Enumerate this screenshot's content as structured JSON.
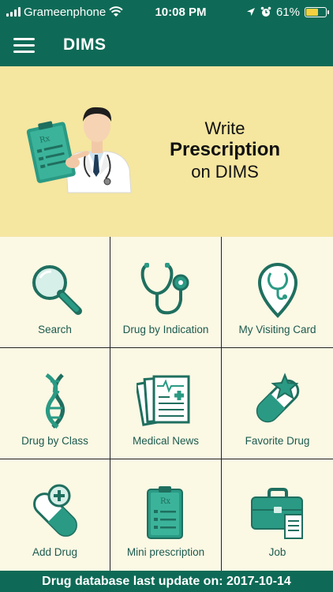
{
  "status_bar": {
    "carrier": "Grameenphone",
    "time": "10:08 PM",
    "battery_percent": "61%",
    "battery_level": 0.61,
    "icons": [
      "signal-icon",
      "wifi-icon",
      "location-icon",
      "alarm-icon",
      "battery-icon"
    ]
  },
  "app_bar": {
    "title": "DIMS",
    "menu_icon": "hamburger-menu-icon"
  },
  "banner": {
    "line1": "Write",
    "line2": "Prescription",
    "line3": "on DIMS",
    "illustration": "doctor-with-prescription-illustration"
  },
  "menu_items": [
    {
      "label": "Search",
      "icon": "magnifier-icon"
    },
    {
      "label": "Drug by Indication",
      "icon": "stethoscope-icon"
    },
    {
      "label": "My Visiting Card",
      "icon": "location-stethoscope-icon"
    },
    {
      "label": "Drug by Class",
      "icon": "dna-icon"
    },
    {
      "label": "Medical News",
      "icon": "documents-icon"
    },
    {
      "label": "Favorite Drug",
      "icon": "capsule-star-icon"
    },
    {
      "label": "Add Drug",
      "icon": "capsule-plus-icon"
    },
    {
      "label": "Mini prescription",
      "icon": "clipboard-rx-icon"
    },
    {
      "label": "Job",
      "icon": "briefcase-icon"
    }
  ],
  "footer": {
    "text": "Drug database last update on: 2017-10-14"
  },
  "colors": {
    "primary": "#0e6a56",
    "banner": "#f5e6a0",
    "grid_bg": "#fbf8e4",
    "icon_teal": "#2a9a84",
    "label": "#1b5a4e"
  }
}
